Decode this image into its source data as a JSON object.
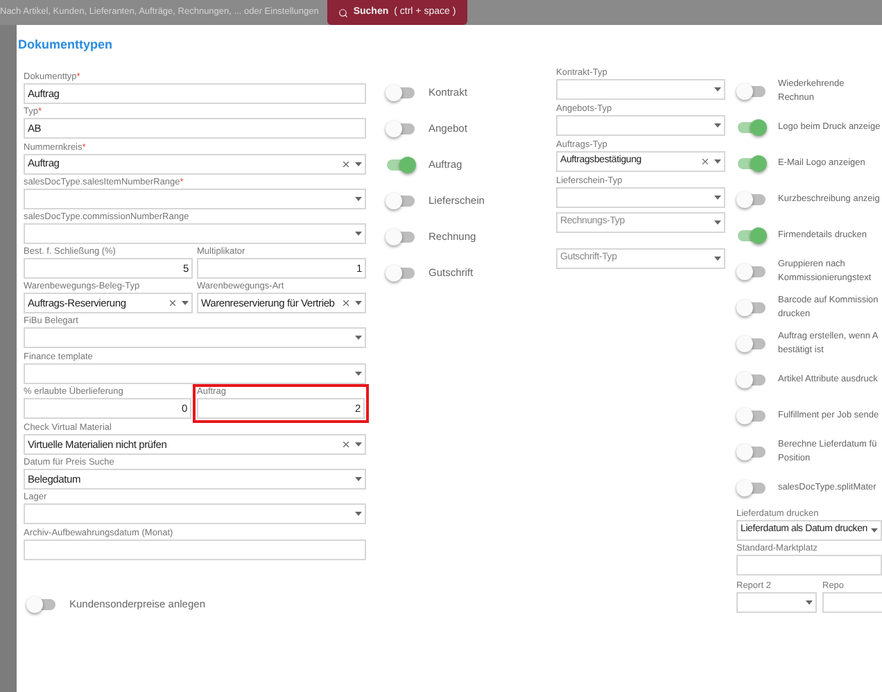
{
  "topbar": {
    "search_placeholder": "Nach Artikel, Kunden, Lieferanten, Aufträge, Rechnungen, ... oder Einstellungen",
    "search_button": {
      "label": "Suchen",
      "shortcut": "( ctrl + space )"
    }
  },
  "dialog": {
    "title": "Dokumenttypen",
    "fields": [
      {
        "kind": "text",
        "label": "Dokumenttyp",
        "required_mark": "*",
        "value": "Auftrag"
      },
      {
        "kind": "text",
        "label": "Typ",
        "required_mark": "*",
        "value": "AB"
      },
      {
        "kind": "select",
        "label": "Nummernkreis",
        "required_mark": "*",
        "value": "Auftrag",
        "clearable": true
      },
      {
        "kind": "select",
        "label": "salesDocType.salesItemNumberRange",
        "required_mark": "*"
      },
      {
        "kind": "select",
        "label": "salesDocType.commissionNumberRange"
      },
      {
        "kind": "pair",
        "items": [
          {
            "kind": "number",
            "label": "Best. f. Schließung (%)",
            "value": "5"
          },
          {
            "kind": "number",
            "label": "Multiplikator",
            "value": "1"
          }
        ]
      },
      {
        "kind": "pair",
        "items": [
          {
            "kind": "select",
            "label": "Warenbewegungs-Beleg-Typ",
            "value": "Auftrags-Reservierung",
            "clearable": true
          },
          {
            "kind": "select",
            "label": "Warenbewegungs-Art",
            "value": "Warenreservierung für Vertrieb",
            "clearable": true
          }
        ]
      },
      {
        "kind": "select",
        "label": "FiBu Belegart"
      },
      {
        "kind": "select",
        "label": "Finance template"
      },
      {
        "kind": "pair",
        "items": [
          {
            "kind": "number",
            "label": "% erlaubte Überlieferung",
            "value": "0"
          },
          {
            "kind": "number",
            "label": "Auftrag",
            "value": "2",
            "highlighted": true
          }
        ]
      },
      {
        "kind": "select",
        "label": "Check Virtual Material",
        "value": "Virtuelle Materialien nicht prüfen",
        "clearable": true
      },
      {
        "kind": "select",
        "label": "Datum für Preis Suche",
        "value": "Belegdatum",
        "clearable": false
      },
      {
        "kind": "select",
        "label": "Lager"
      },
      {
        "kind": "text",
        "label": "Archiv-Aufbewahrungsdatum (Monat)"
      },
      {
        "kind": "toggle",
        "label": "Kundensonderpreise anlegen",
        "on": false
      }
    ],
    "doc_toggles": [
      {
        "label": "Kontrakt",
        "on": false
      },
      {
        "label": "Angebot",
        "on": false
      },
      {
        "label": "Auftrag",
        "on": true
      },
      {
        "label": "Lieferschein",
        "on": false
      },
      {
        "label": "Rechnung",
        "on": false
      },
      {
        "label": "Gutschrift",
        "on": false
      }
    ],
    "type_selects": [
      {
        "label": "Kontrakt-Typ"
      },
      {
        "label": "Angebots-Typ"
      },
      {
        "label": "Auftrags-Typ",
        "value": "Auftragsbestätigung",
        "clearable": true
      },
      {
        "label": "Lieferschein-Typ"
      },
      {
        "placeholder": "Rechnungs-Typ"
      },
      {
        "placeholder": "Gutschrift-Typ"
      }
    ],
    "options": [
      {
        "kind": "toggle",
        "label": "Wiederkehrende Rechnun",
        "on": false
      },
      {
        "kind": "toggle",
        "label": "Logo beim Druck anzeige",
        "on": true
      },
      {
        "kind": "toggle",
        "label": "E-Mail Logo anzeigen",
        "on": true
      },
      {
        "kind": "toggle",
        "label": "Kurzbeschreibung anzeig",
        "on": false
      },
      {
        "kind": "toggle",
        "label": "Firmendetails drucken",
        "on": true
      },
      {
        "kind": "toggle",
        "label": "Gruppieren nach Kommissionierungstext",
        "on": false
      },
      {
        "kind": "toggle",
        "label": "Barcode auf Kommission drucken",
        "on": false
      },
      {
        "kind": "toggle",
        "label": "Auftrag erstellen, wenn A bestätigt ist",
        "on": false
      },
      {
        "kind": "toggle",
        "label": "Artikel Attribute ausdruck",
        "on": false
      },
      {
        "kind": "toggle",
        "label": "Fulfillment per Job sende",
        "on": false
      },
      {
        "kind": "toggle",
        "label": "Berechne Lieferdatum fü Position",
        "on": false
      },
      {
        "kind": "toggle",
        "label": "salesDocType.splitMater",
        "on": false
      },
      {
        "kind": "select",
        "label": "Lieferdatum drucken",
        "value": "Lieferdatum als Datum drucken"
      },
      {
        "kind": "text",
        "label": "Standard-Marktplatz"
      },
      {
        "kind": "pair",
        "items": [
          {
            "label": "Report 2"
          },
          {
            "label": "Repo"
          }
        ]
      }
    ]
  }
}
